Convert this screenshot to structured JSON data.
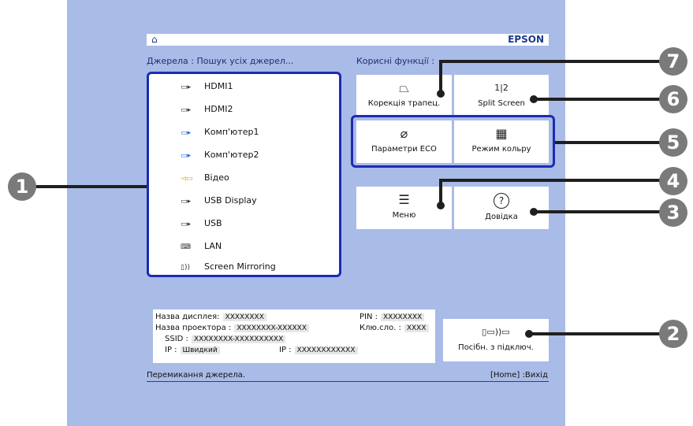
{
  "topbar": {
    "home_icon": "⌂",
    "brand": "EPSON"
  },
  "sources_heading": "Джерела :  Пошук усіх джерел...",
  "functions_heading": "Корисні функції :",
  "sources": [
    {
      "icon": "▭▸",
      "label": "HDMI1"
    },
    {
      "icon": "▭▸",
      "label": "HDMI2"
    },
    {
      "icon": "▭▸",
      "label": "Комп'ютер1"
    },
    {
      "icon": "▭▸",
      "label": "Комп'ютер2"
    },
    {
      "icon": "◅▭",
      "label": "Відео"
    },
    {
      "icon": "▭▸",
      "label": "USB Display"
    },
    {
      "icon": "▭▸",
      "label": "USB"
    },
    {
      "icon": "⌨",
      "label": "LAN"
    },
    {
      "icon": "▯))",
      "label": "Screen Mirroring"
    }
  ],
  "functions": {
    "keystone": {
      "icon": "⏢",
      "label": "Корекція трапец."
    },
    "split": {
      "icon": "1|2",
      "label": "Split Screen"
    },
    "eco": {
      "icon": "⌀",
      "label": "Параметри ECO"
    },
    "color": {
      "icon": "▦",
      "label": "Режим кольру"
    },
    "menu": {
      "icon": "☰",
      "label": "Меню"
    },
    "help": {
      "icon": "?",
      "label": "Довідка"
    }
  },
  "info": {
    "display_name_label": "Назва дисплея:",
    "display_name_value": "XXXXXXXX",
    "pin_label": "PIN :",
    "pin_value": "XXXXXXXX",
    "projector_name_label": "Назва проектора :",
    "projector_name_value": "XXXXXXXX-XXXXXX",
    "key_label": "Клю.сло. :",
    "key_value": "XXXX",
    "ssid_label": "SSID :",
    "ssid_value": "XXXXXXXX-XXXXXXXXXX",
    "ip_label": "IP :",
    "ip_value": "Швидкий",
    "ip2_label": "IP :",
    "ip2_value": "XXXXXXXXXXXX"
  },
  "connect_guide": {
    "icon": "▯▭))▭",
    "label": "Посібн. з підключ."
  },
  "status": {
    "left": "Перемикання джерела.",
    "right": "[Home] :Вихід"
  },
  "callouts": [
    "1",
    "2",
    "3",
    "4",
    "5",
    "6",
    "7"
  ],
  "colors": {
    "screen_bg": "#a9bbe7",
    "frame": "#1d2bb3",
    "badge": "#7a7a7a"
  }
}
